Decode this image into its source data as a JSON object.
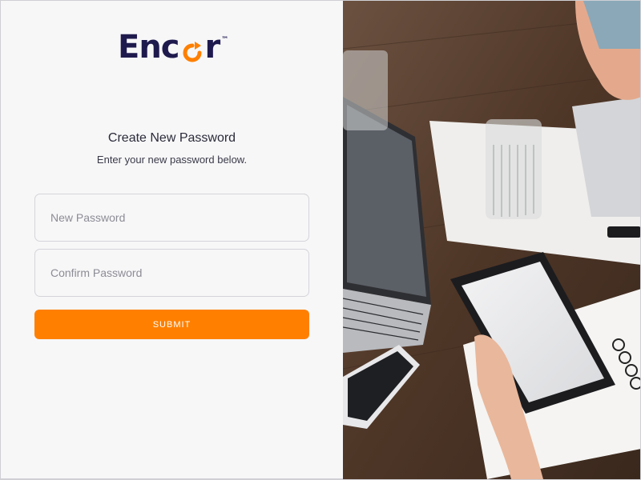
{
  "brand": {
    "logo_prefix": "Enc",
    "logo_suffix": "r",
    "trademark": "™",
    "text_color": "#1f1a4d",
    "accent_color": "#ff8000"
  },
  "form": {
    "title": "Create New Password",
    "subtitle": "Enter your new password below.",
    "new_password_placeholder": "New Password",
    "confirm_password_placeholder": "Confirm Password",
    "submit_label": "SUBMIT"
  },
  "hero_image": {
    "icon": "workspace-photo"
  }
}
